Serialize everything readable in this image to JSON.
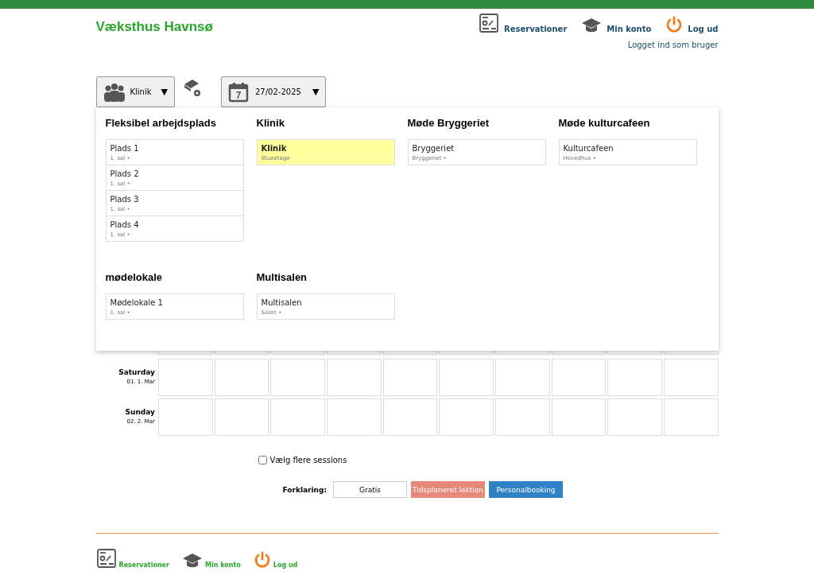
{
  "site_title": "Væksthus Havnsø",
  "nav": [
    {
      "kind": "reservations",
      "label": "Reservationer"
    },
    {
      "kind": "account",
      "label": "Min konto"
    },
    {
      "kind": "logout",
      "label": "Log ud"
    }
  ],
  "login_status": "Logget ind som bruger",
  "toolbar": {
    "resource_select": {
      "value": "Klinik",
      "caret": "▼"
    },
    "date_select": {
      "day": "7",
      "value": "27/02-2025",
      "caret": "▼"
    }
  },
  "resource_menu": {
    "groups": [
      {
        "title": "Fleksibel arbejdsplads",
        "items": [
          {
            "name": "Plads 1",
            "location": "1. sal •",
            "selected": false
          },
          {
            "name": "Plads 2",
            "location": "1. sal •",
            "selected": false
          },
          {
            "name": "Plads 3",
            "location": "1. sal •",
            "selected": false
          },
          {
            "name": "Plads 4",
            "location": "1. sal •",
            "selected": false
          }
        ]
      },
      {
        "title": "Klinik",
        "items": [
          {
            "name": "Klinik",
            "location": "Stueetage",
            "selected": true
          }
        ]
      },
      {
        "title": "Møde Bryggeriet",
        "items": [
          {
            "name": "Bryggeriet",
            "location": "Bryggeriet •",
            "selected": false
          }
        ]
      },
      {
        "title": "Møde kulturcafeen",
        "items": [
          {
            "name": "Kulturcafeen",
            "location": "Hovedhus •",
            "selected": false
          }
        ]
      },
      {
        "title": "mødelokale",
        "items": [
          {
            "name": "Mødelokale 1",
            "location": "1. sal •",
            "selected": false
          }
        ]
      },
      {
        "title": "Multisalen",
        "items": [
          {
            "name": "Multisalen",
            "location": "Salen •",
            "selected": false
          }
        ]
      }
    ]
  },
  "calendar": {
    "days": [
      {
        "day": "Saturday",
        "date": "01. 1. Mar"
      },
      {
        "day": "Sunday",
        "date": "02. 2. Mar"
      }
    ]
  },
  "multi_session": {
    "label": "Vælg flere sessions",
    "checked": false
  },
  "legend": {
    "label": "Forklaring:",
    "items": [
      {
        "kind": "free",
        "label": "Gratis"
      },
      {
        "kind": "scheduled",
        "label": "Tidsplaneret lektion"
      },
      {
        "kind": "staff",
        "label": "Personalbooking"
      }
    ]
  },
  "footer_nav": [
    {
      "kind": "reservations",
      "label": "Reservationer"
    },
    {
      "kind": "account",
      "label": "Min konto"
    },
    {
      "kind": "logout",
      "label": "Log ud"
    }
  ]
}
